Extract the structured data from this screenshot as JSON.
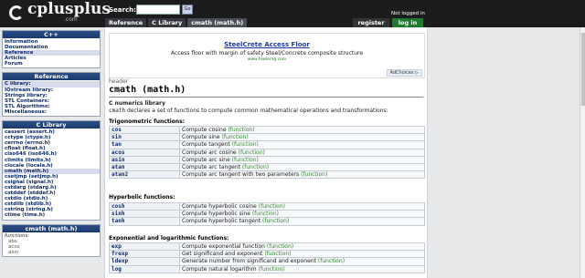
{
  "header": {
    "logo_text": "cplusplus",
    "logo_com": ".com",
    "search_label": "Search:",
    "search_value": "",
    "go_label": "Go",
    "breadcrumbs": [
      "Reference",
      "C Library",
      "cmath (math.h)"
    ],
    "not_logged_in": "Not logged in",
    "register_label": "register",
    "login_label": "log in"
  },
  "sidebar": {
    "cpp": {
      "title": "C++",
      "items": [
        "Information",
        "Documentation",
        "Reference",
        "Articles",
        "Forum"
      ]
    },
    "reference": {
      "title": "Reference",
      "items": [
        "C library:",
        "IOstream library:",
        "Strings library:",
        "STL Containers:",
        "STL Algorithms:",
        "Miscellaneous:"
      ]
    },
    "clib": {
      "title": "C Library",
      "items": [
        "cassert (assert.h)",
        "cctype (ctype.h)",
        "cerrno (errno.h)",
        "cfloat (float.h)",
        "ciso646 (iso646.h)",
        "climits (limits.h)",
        "clocale (locale.h)",
        "cmath (math.h)",
        "csetjmp (setjmp.h)",
        "csignal (signal.h)",
        "cstdarg (stdarg.h)",
        "cstddef (stddef.h)",
        "cstdio (stdio.h)",
        "cstdlib (stdlib.h)",
        "cstring (string.h)",
        "ctime (time.h)"
      ]
    },
    "cmath": {
      "title": "cmath (math.h)",
      "functions_label": "functions:",
      "items": [
        "abs",
        "acos",
        "asin"
      ]
    }
  },
  "ad": {
    "title": "SteelCrete Access Floor",
    "text": "Access floor with margin of safety Steel/Concrete composite structure",
    "url": "www.fowlerng.com",
    "adchoices": "AdChoices ▷"
  },
  "page": {
    "kind": "header",
    "title": "cmath (math.h)",
    "subtitle": "C numerics library",
    "desc_prefix": "cmath",
    "desc_rest": " declares a set of functions to compute common mathematical operations and transformations:",
    "tag": "(function)"
  },
  "sections": [
    {
      "title": "Trigonometric functions:",
      "rows": [
        {
          "name": "cos",
          "desc": "Compute cosine"
        },
        {
          "name": "sin",
          "desc": "Compute sine"
        },
        {
          "name": "tan",
          "desc": "Compute tangent"
        },
        {
          "name": "acos",
          "desc": "Compute arc cosine"
        },
        {
          "name": "asin",
          "desc": "Compute arc sine"
        },
        {
          "name": "atan",
          "desc": "Compute arc tangent"
        },
        {
          "name": "atan2",
          "desc": "Compute arc tangent with two parameters"
        }
      ]
    },
    {
      "title": "Hyperbolic functions:",
      "rows": [
        {
          "name": "cosh",
          "desc": "Compute hyperbolic cosine"
        },
        {
          "name": "sinh",
          "desc": "Compute hyperbolic sine"
        },
        {
          "name": "tanh",
          "desc": "Compute hyperbolic tangent"
        }
      ]
    },
    {
      "title": "Exponential and logarithmic functions:",
      "rows": [
        {
          "name": "exp",
          "desc": "Compute exponential function"
        },
        {
          "name": "frexp",
          "desc": "Get significand and exponent"
        },
        {
          "name": "ldexp",
          "desc": "Generate number from significand and exponent"
        },
        {
          "name": "log",
          "desc": "Compute natural logarithm"
        }
      ]
    }
  ]
}
